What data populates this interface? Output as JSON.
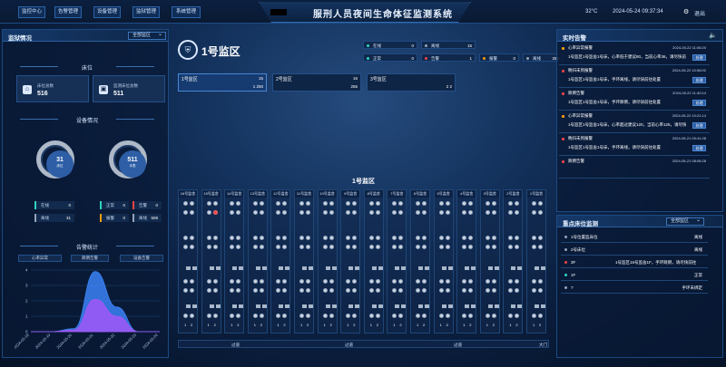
{
  "nav": [
    "监控中心",
    "告警管理",
    "设备管理",
    "监狱管理",
    "系统管理"
  ],
  "title": "戒毒所/监狱羁押服刑人员夜间生命体征监测系统",
  "titleShown": "服刑人员夜间生命体征监测系统",
  "header": {
    "temp": "32°C",
    "datetime": "2024-05-24 09:37:34",
    "user": "admin",
    "user_label": "退出"
  },
  "left": {
    "panel_title": "监狱情况",
    "select": "全部监区",
    "bed_section": "床位",
    "bed_total_label": "床位总数",
    "bed_total": "516",
    "bed_monitor_label": "监测床位总数",
    "bed_monitor": "511",
    "device_section": "设备情况",
    "ring1": {
      "value": "31",
      "label": "床位"
    },
    "ring2": {
      "value": "511",
      "label": "手表"
    },
    "stats": [
      {
        "l": "在线",
        "v": "0",
        "c": "#2dd4bf"
      },
      {
        "l": "离线",
        "v": "31",
        "c": "#94a3b8"
      },
      {
        "l": "正常",
        "v": "0",
        "c": "#2dd4bf"
      },
      {
        "l": "告警",
        "v": "0",
        "c": "#ef4444"
      },
      {
        "l": "报警",
        "v": "0",
        "c": "#f59e0b"
      },
      {
        "l": "离线",
        "v": "508",
        "c": "#94a3b8"
      }
    ],
    "alarm_section": "告警统计",
    "tabs": [
      "心率异常",
      "跌倒告警",
      "设备告警"
    ]
  },
  "chart_data": {
    "type": "area",
    "x": [
      "2024-05-18",
      "2024-05-19",
      "2024-05-20",
      "2024-05-21",
      "2024-05-22",
      "2024-05-23",
      "2024-05-24"
    ],
    "series": [
      {
        "name": "心率异常",
        "values": [
          0,
          0,
          0.2,
          3.9,
          1.6,
          0,
          0
        ]
      },
      {
        "name": "跌倒告警",
        "values": [
          0,
          0,
          0.1,
          2.1,
          1.0,
          0,
          0
        ]
      }
    ],
    "yticks": [
      "4",
      "3",
      "2",
      "1",
      "0"
    ],
    "ylim": [
      0,
      4
    ]
  },
  "center": {
    "icon": "police-badge-icon",
    "room": "1号监区",
    "legend": [
      {
        "l": "在线",
        "v": "0",
        "c": "#2dd4bf"
      },
      {
        "l": "离线",
        "v": "15",
        "c": "#94a3b8"
      },
      {
        "l": "正常",
        "v": "0",
        "c": "#2dd4bf"
      },
      {
        "l": "告警",
        "v": "1",
        "c": "#ef4444"
      },
      {
        "l": "报警",
        "v": "0",
        "c": "#f59e0b"
      },
      {
        "l": "离线",
        "v": "250",
        "c": "#94a3b8"
      }
    ],
    "areas": [
      {
        "n": "1号监区",
        "c1": "15",
        "c2": "1  250",
        "a": true
      },
      {
        "n": "2号监区",
        "c1": "16",
        "c2": "256",
        "a": false
      },
      {
        "n": "3号监区",
        "c1": "",
        "c2": "2  2",
        "a": false
      }
    ],
    "cells_title": "1号监区",
    "cells": [
      "16号监舍",
      "15号监舍",
      "14号监舍",
      "13号监舍",
      "12号监舍",
      "11号监舍",
      "10号监舍",
      "9号监舍",
      "8号监舍",
      "7号监舍",
      "6号监舍",
      "5号监舍",
      "4号监舍",
      "3号监舍",
      "2号监舍",
      "1号监舍"
    ],
    "bottom": [
      "过道",
      "过道",
      "过道",
      "大门"
    ]
  },
  "right": {
    "alarm_title": "实时告警",
    "alarms": [
      {
        "t": "心率异常报警",
        "time": "2024-05-22 11:06:20",
        "desc": "1号监区1号监舍1号床，心率低于建议80，当前心率36，请尽快前往处置",
        "c": "#f59e0b",
        "btn": "处理"
      },
      {
        "t": "晚归未到报警",
        "time": "2024-05-22 10:56:02",
        "desc": "1号监区1号监舍1号床，手环离线，请尽快前往处置",
        "c": "#ef4444",
        "btn": "处理"
      },
      {
        "t": "跌倒告警",
        "time": "2024-05-22 11:40:14",
        "desc": "1号监区1号监舍1号床，手环跌倒，请尽快前往处置",
        "c": "#ef4444",
        "btn": "处理"
      },
      {
        "t": "心率异常报警",
        "time": "2024-05-22 10:21:14",
        "desc": "1号监区1号监舍1号床，心率超过建议120，当前心率125，请尽快前往处置",
        "c": "#f59e0b",
        "btn": "处理"
      },
      {
        "t": "晚归未到报警",
        "time": "2024-05-21 09:41:28",
        "desc": "1号监区1号监舍1号床，手环离线，请尽快前往处置",
        "c": "#ef4444",
        "btn": "处理"
      },
      {
        "t": "跌倒告警",
        "time": "2024-05-21 08:08:28",
        "desc": "",
        "c": "#ef4444",
        "btn": ""
      }
    ],
    "key_title": "重点床位监测",
    "key_select": "全部监区",
    "keys": [
      {
        "n": "1号位置监床位",
        "m": "",
        "s": "离线",
        "c": "#94a3b8"
      },
      {
        "n": "2号床位",
        "m": "",
        "s": "离线",
        "c": "#94a3b8"
      },
      {
        "n": "3F",
        "m": "1号监区16号监舍1F，手环跌倒，请尽快前往",
        "s": "",
        "c": "#ef4444"
      },
      {
        "n": "1F",
        "m": "",
        "s": "正常",
        "c": "#2dd4bf"
      },
      {
        "n": "?",
        "m": "",
        "s": "手环未绑定",
        "c": "#94a3b8"
      }
    ]
  }
}
